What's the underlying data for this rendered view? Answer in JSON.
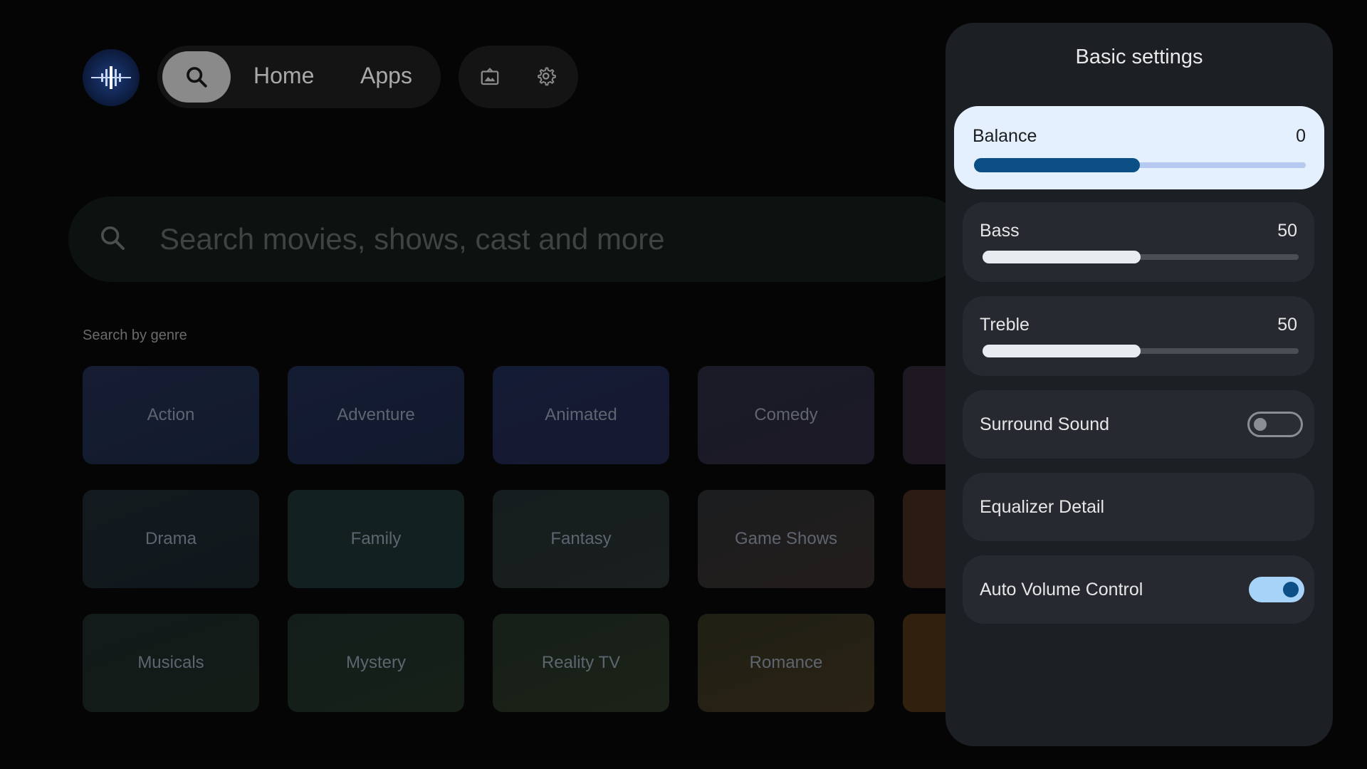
{
  "nav": {
    "home_label": "Home",
    "apps_label": "Apps"
  },
  "search": {
    "placeholder": "Search movies, shows, cast and more"
  },
  "genres": {
    "title": "Search by genre",
    "items": [
      "Action",
      "Adventure",
      "Animated",
      "Comedy",
      "Drama",
      "Family",
      "Fantasy",
      "Game Shows",
      "Musicals",
      "Mystery",
      "Reality TV",
      "Romance"
    ]
  },
  "settings": {
    "title": "Basic settings",
    "balance": {
      "label": "Balance",
      "value": "0",
      "level": 0.5
    },
    "bass": {
      "label": "Bass",
      "value": "50",
      "level": 0.5
    },
    "treble": {
      "label": "Treble",
      "value": "50",
      "level": 0.5
    },
    "surround": {
      "label": "Surround Sound",
      "enabled": false
    },
    "equalizer": {
      "label": "Equalizer Detail"
    },
    "auto_volume": {
      "label": "Auto Volume Control",
      "enabled": true
    }
  },
  "colors": {
    "accent": "#0b4f86",
    "focused_card": "#e4f0fd",
    "toggle_on": "#a7d3f8"
  }
}
